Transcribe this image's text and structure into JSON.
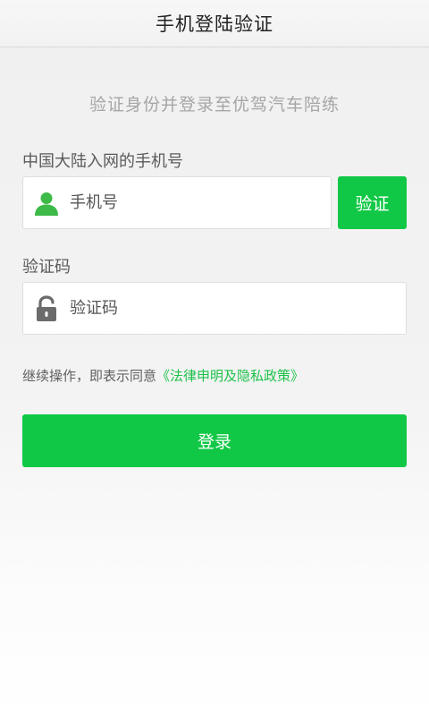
{
  "header": {
    "title": "手机登陆验证"
  },
  "subtitle": "验证身份并登录至优驾汽车陪练",
  "phone": {
    "label": "中国大陆入网的手机号",
    "placeholder": "手机号",
    "icon": "user-icon",
    "icon_color": "#3dba47"
  },
  "verify_button": {
    "label": "验证"
  },
  "code": {
    "label": "验证码",
    "placeholder": "验证码",
    "icon": "lock-icon",
    "icon_color": "#6b6b6b"
  },
  "agreement": {
    "prefix": "继续操作，即表示同意",
    "link": "《法律申明及隐私政策》"
  },
  "login_button": {
    "label": "登录"
  },
  "colors": {
    "accent": "#10c845",
    "link": "#1ec24a"
  }
}
